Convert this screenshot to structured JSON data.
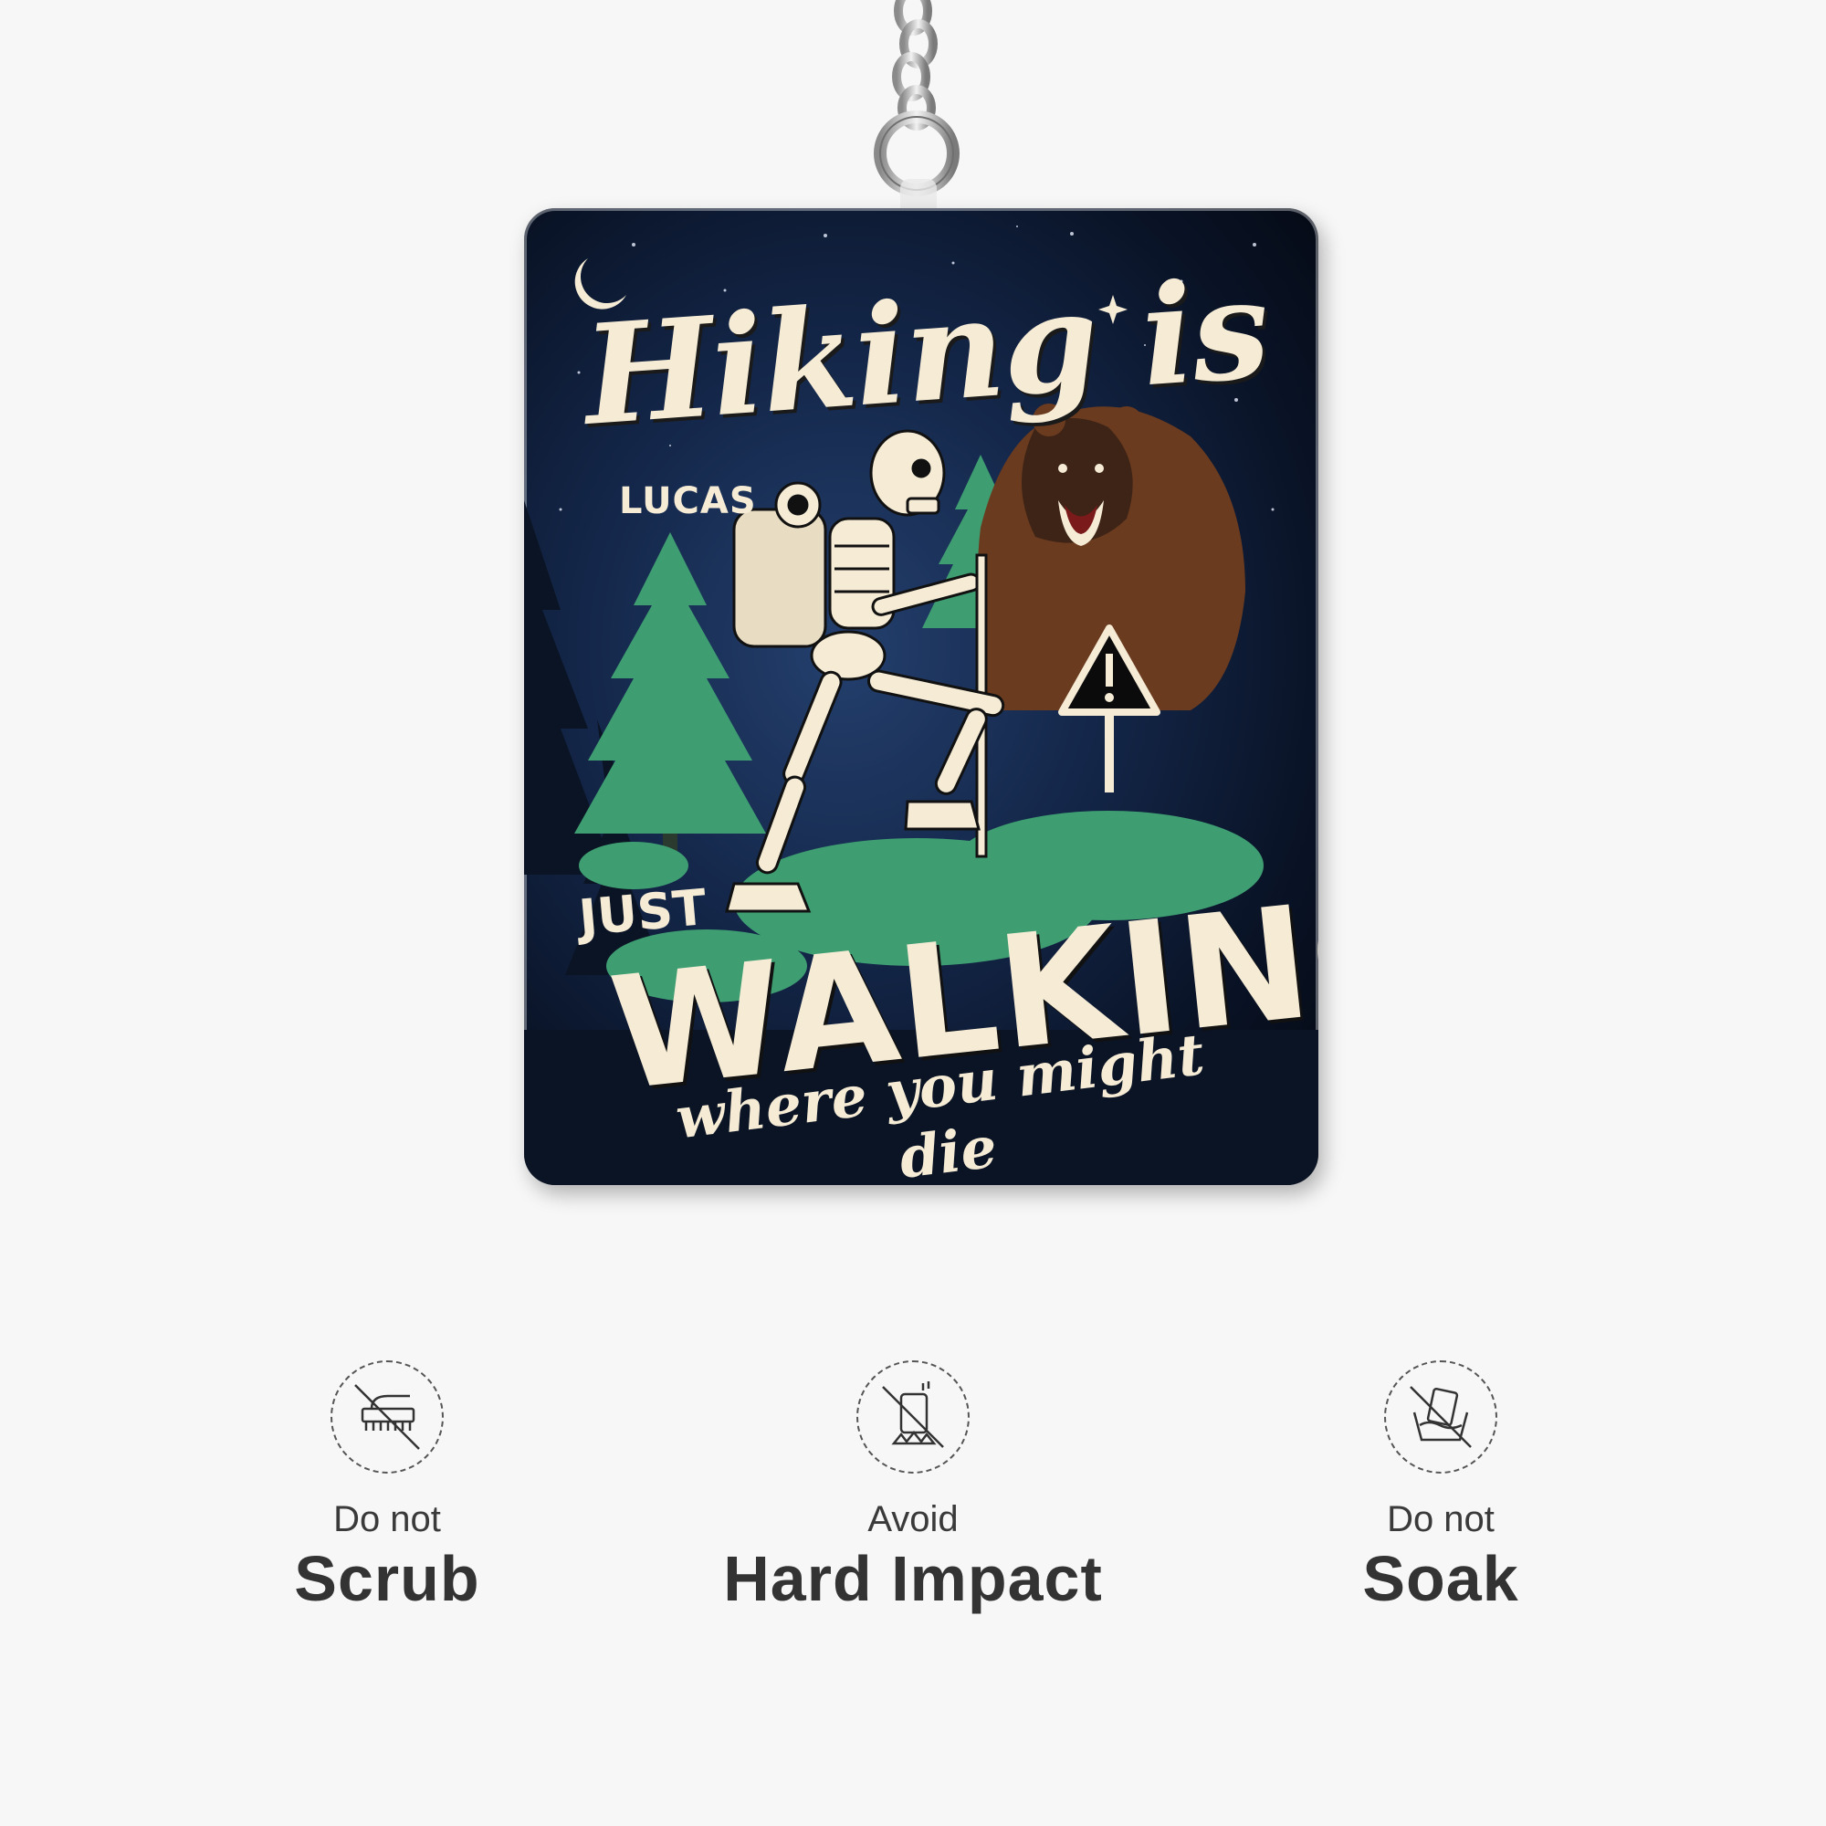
{
  "product": {
    "title_line1": "Hiking is",
    "name": "LUCAS",
    "title_line2": "JUST",
    "title_line3": "WALKING",
    "tagline": "where you might die"
  },
  "care_instructions": [
    {
      "top": "Do not",
      "main": "Scrub",
      "icon": "no-scrub-brush-icon"
    },
    {
      "top": "Avoid",
      "main": "Hard Impact",
      "icon": "no-drop-impact-icon"
    },
    {
      "top": "Do not",
      "main": "Soak",
      "icon": "no-soak-icon"
    }
  ],
  "colors": {
    "background": "#f7f7f7",
    "keychain_dark": "#0a1428",
    "cream_text": "#f6ecd6",
    "tree_green": "#3e9e72",
    "bear_brown": "#6b3b1f",
    "label_text": "#333333"
  }
}
